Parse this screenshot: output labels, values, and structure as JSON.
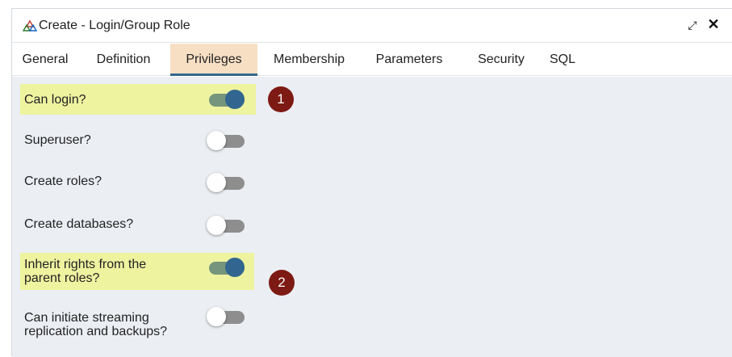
{
  "window": {
    "title": "Create - Login/Group Role",
    "title_icon": "pgadmin-role-icon",
    "maximize_glyph": "⤢",
    "close_glyph": "✕"
  },
  "tabs": [
    {
      "label": "General",
      "active": false
    },
    {
      "label": "Definition",
      "active": false
    },
    {
      "label": "Privileges",
      "active": true
    },
    {
      "label": "Membership",
      "active": false
    },
    {
      "label": "Parameters",
      "active": false
    },
    {
      "label": "Security",
      "active": false
    },
    {
      "label": "SQL",
      "active": false
    }
  ],
  "privileges": [
    {
      "label": "Can login?",
      "enabled": true,
      "highlighted": true,
      "badge": "1"
    },
    {
      "label": "Superuser?",
      "enabled": false,
      "highlighted": false
    },
    {
      "label": "Create roles?",
      "enabled": false,
      "highlighted": false
    },
    {
      "label": "Create databases?",
      "enabled": false,
      "highlighted": false
    },
    {
      "label": "Inherit rights from the parent roles?",
      "enabled": true,
      "highlighted": true,
      "badge": "2"
    },
    {
      "label": "Can initiate streaming replication and backups?",
      "enabled": false,
      "highlighted": false
    }
  ],
  "colors": {
    "toggle_on_knob": "#326690",
    "toggle_on_track": "#75957d",
    "toggle_off_track": "#8e8e8e",
    "highlight": "#eef3a0",
    "badge": "#7d1a13",
    "active_tab_bg": "#f7dfc4"
  }
}
